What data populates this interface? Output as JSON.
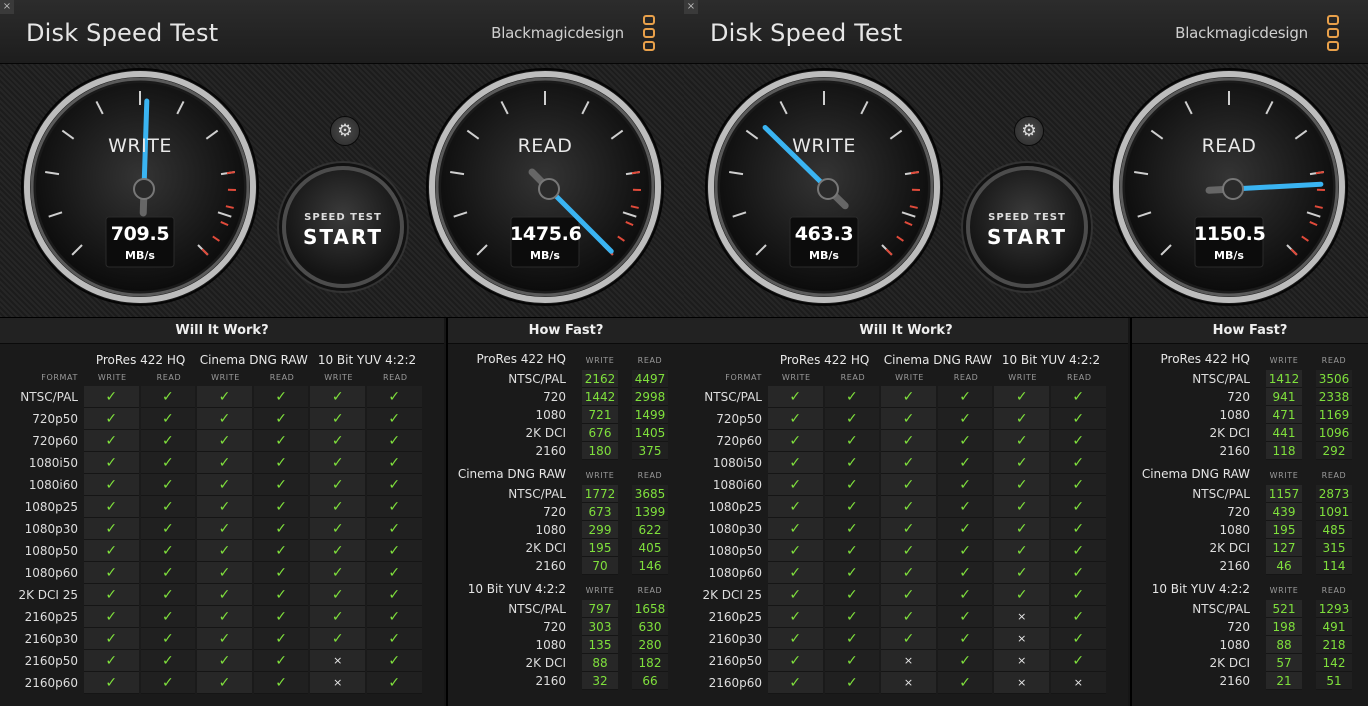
{
  "apps": [
    {
      "title": "Disk Speed Test",
      "brand": "Blackmagicdesign",
      "close": "×",
      "gear": "⚙",
      "start_top": "SPEED TEST",
      "start_main": "START",
      "write": {
        "label": "WRITE",
        "value": "709.5",
        "unit": "MB/s",
        "speed": 709.5
      },
      "read": {
        "label": "READ",
        "value": "1475.6",
        "unit": "MB/s",
        "speed": 1475.6
      },
      "will_it_work": {
        "title": "Will It Work?",
        "format_header": "FORMAT",
        "groups": [
          "ProRes 422 HQ",
          "Cinema DNG RAW",
          "10 Bit YUV 4:2:2"
        ],
        "sub": [
          "WRITE",
          "READ"
        ],
        "rows": [
          {
            "format": "NTSC/PAL",
            "cells": [
              1,
              1,
              1,
              1,
              1,
              1
            ]
          },
          {
            "format": "720p50",
            "cells": [
              1,
              1,
              1,
              1,
              1,
              1
            ]
          },
          {
            "format": "720p60",
            "cells": [
              1,
              1,
              1,
              1,
              1,
              1
            ]
          },
          {
            "format": "1080i50",
            "cells": [
              1,
              1,
              1,
              1,
              1,
              1
            ]
          },
          {
            "format": "1080i60",
            "cells": [
              1,
              1,
              1,
              1,
              1,
              1
            ]
          },
          {
            "format": "1080p25",
            "cells": [
              1,
              1,
              1,
              1,
              1,
              1
            ]
          },
          {
            "format": "1080p30",
            "cells": [
              1,
              1,
              1,
              1,
              1,
              1
            ]
          },
          {
            "format": "1080p50",
            "cells": [
              1,
              1,
              1,
              1,
              1,
              1
            ]
          },
          {
            "format": "1080p60",
            "cells": [
              1,
              1,
              1,
              1,
              1,
              1
            ]
          },
          {
            "format": "2K DCI 25",
            "cells": [
              1,
              1,
              1,
              1,
              1,
              1
            ]
          },
          {
            "format": "2160p25",
            "cells": [
              1,
              1,
              1,
              1,
              1,
              1
            ]
          },
          {
            "format": "2160p30",
            "cells": [
              1,
              1,
              1,
              1,
              1,
              1
            ]
          },
          {
            "format": "2160p50",
            "cells": [
              1,
              1,
              1,
              1,
              0,
              1
            ]
          },
          {
            "format": "2160p60",
            "cells": [
              1,
              1,
              1,
              1,
              0,
              1
            ]
          }
        ]
      },
      "how_fast": {
        "title": "How Fast?",
        "sub": [
          "WRITE",
          "READ"
        ],
        "groups": [
          {
            "name": "ProRes 422 HQ",
            "rows": [
              {
                "label": "NTSC/PAL",
                "write": "2162",
                "read": "4497"
              },
              {
                "label": "720",
                "write": "1442",
                "read": "2998"
              },
              {
                "label": "1080",
                "write": "721",
                "read": "1499"
              },
              {
                "label": "2K DCI",
                "write": "676",
                "read": "1405"
              },
              {
                "label": "2160",
                "write": "180",
                "read": "375"
              }
            ]
          },
          {
            "name": "Cinema DNG RAW",
            "rows": [
              {
                "label": "NTSC/PAL",
                "write": "1772",
                "read": "3685"
              },
              {
                "label": "720",
                "write": "673",
                "read": "1399"
              },
              {
                "label": "1080",
                "write": "299",
                "read": "622"
              },
              {
                "label": "2K DCI",
                "write": "195",
                "read": "405"
              },
              {
                "label": "2160",
                "write": "70",
                "read": "146"
              }
            ]
          },
          {
            "name": "10 Bit YUV 4:2:2",
            "rows": [
              {
                "label": "NTSC/PAL",
                "write": "797",
                "read": "1658"
              },
              {
                "label": "720",
                "write": "303",
                "read": "630"
              },
              {
                "label": "1080",
                "write": "135",
                "read": "280"
              },
              {
                "label": "2K DCI",
                "write": "88",
                "read": "182"
              },
              {
                "label": "2160",
                "write": "32",
                "read": "66"
              }
            ]
          }
        ]
      }
    },
    {
      "title": "Disk Speed Test",
      "brand": "Blackmagicdesign",
      "close": "×",
      "gear": "⚙",
      "start_top": "SPEED TEST",
      "start_main": "START",
      "write": {
        "label": "WRITE",
        "value": "463.3",
        "unit": "MB/s",
        "speed": 463.3
      },
      "read": {
        "label": "READ",
        "value": "1150.5",
        "unit": "MB/s",
        "speed": 1150.5
      },
      "will_it_work": {
        "title": "Will It Work?",
        "format_header": "FORMAT",
        "groups": [
          "ProRes 422 HQ",
          "Cinema DNG RAW",
          "10 Bit YUV 4:2:2"
        ],
        "sub": [
          "WRITE",
          "READ"
        ],
        "rows": [
          {
            "format": "NTSC/PAL",
            "cells": [
              1,
              1,
              1,
              1,
              1,
              1
            ]
          },
          {
            "format": "720p50",
            "cells": [
              1,
              1,
              1,
              1,
              1,
              1
            ]
          },
          {
            "format": "720p60",
            "cells": [
              1,
              1,
              1,
              1,
              1,
              1
            ]
          },
          {
            "format": "1080i50",
            "cells": [
              1,
              1,
              1,
              1,
              1,
              1
            ]
          },
          {
            "format": "1080i60",
            "cells": [
              1,
              1,
              1,
              1,
              1,
              1
            ]
          },
          {
            "format": "1080p25",
            "cells": [
              1,
              1,
              1,
              1,
              1,
              1
            ]
          },
          {
            "format": "1080p30",
            "cells": [
              1,
              1,
              1,
              1,
              1,
              1
            ]
          },
          {
            "format": "1080p50",
            "cells": [
              1,
              1,
              1,
              1,
              1,
              1
            ]
          },
          {
            "format": "1080p60",
            "cells": [
              1,
              1,
              1,
              1,
              1,
              1
            ]
          },
          {
            "format": "2K DCI 25",
            "cells": [
              1,
              1,
              1,
              1,
              1,
              1
            ]
          },
          {
            "format": "2160p25",
            "cells": [
              1,
              1,
              1,
              1,
              0,
              1
            ]
          },
          {
            "format": "2160p30",
            "cells": [
              1,
              1,
              1,
              1,
              0,
              1
            ]
          },
          {
            "format": "2160p50",
            "cells": [
              1,
              1,
              0,
              1,
              0,
              1
            ]
          },
          {
            "format": "2160p60",
            "cells": [
              1,
              1,
              0,
              1,
              0,
              0
            ]
          }
        ]
      },
      "how_fast": {
        "title": "How Fast?",
        "sub": [
          "WRITE",
          "READ"
        ],
        "groups": [
          {
            "name": "ProRes 422 HQ",
            "rows": [
              {
                "label": "NTSC/PAL",
                "write": "1412",
                "read": "3506"
              },
              {
                "label": "720",
                "write": "941",
                "read": "2338"
              },
              {
                "label": "1080",
                "write": "471",
                "read": "1169"
              },
              {
                "label": "2K DCI",
                "write": "441",
                "read": "1096"
              },
              {
                "label": "2160",
                "write": "118",
                "read": "292"
              }
            ]
          },
          {
            "name": "Cinema DNG RAW",
            "rows": [
              {
                "label": "NTSC/PAL",
                "write": "1157",
                "read": "2873"
              },
              {
                "label": "720",
                "write": "439",
                "read": "1091"
              },
              {
                "label": "1080",
                "write": "195",
                "read": "485"
              },
              {
                "label": "2K DCI",
                "write": "127",
                "read": "315"
              },
              {
                "label": "2160",
                "write": "46",
                "read": "114"
              }
            ]
          },
          {
            "name": "10 Bit YUV 4:2:2",
            "rows": [
              {
                "label": "NTSC/PAL",
                "write": "521",
                "read": "1293"
              },
              {
                "label": "720",
                "write": "198",
                "read": "491"
              },
              {
                "label": "1080",
                "write": "88",
                "read": "218"
              },
              {
                "label": "2K DCI",
                "write": "57",
                "read": "142"
              },
              {
                "label": "2160",
                "write": "21",
                "read": "51"
              }
            ]
          }
        ]
      }
    }
  ],
  "glyphs": {
    "check": "✓",
    "cross": "×"
  },
  "colors": {
    "accent": "#3ab4f2",
    "ok": "#7fe03c",
    "redline": "#e04a3a",
    "logo": "#e8a04a"
  }
}
